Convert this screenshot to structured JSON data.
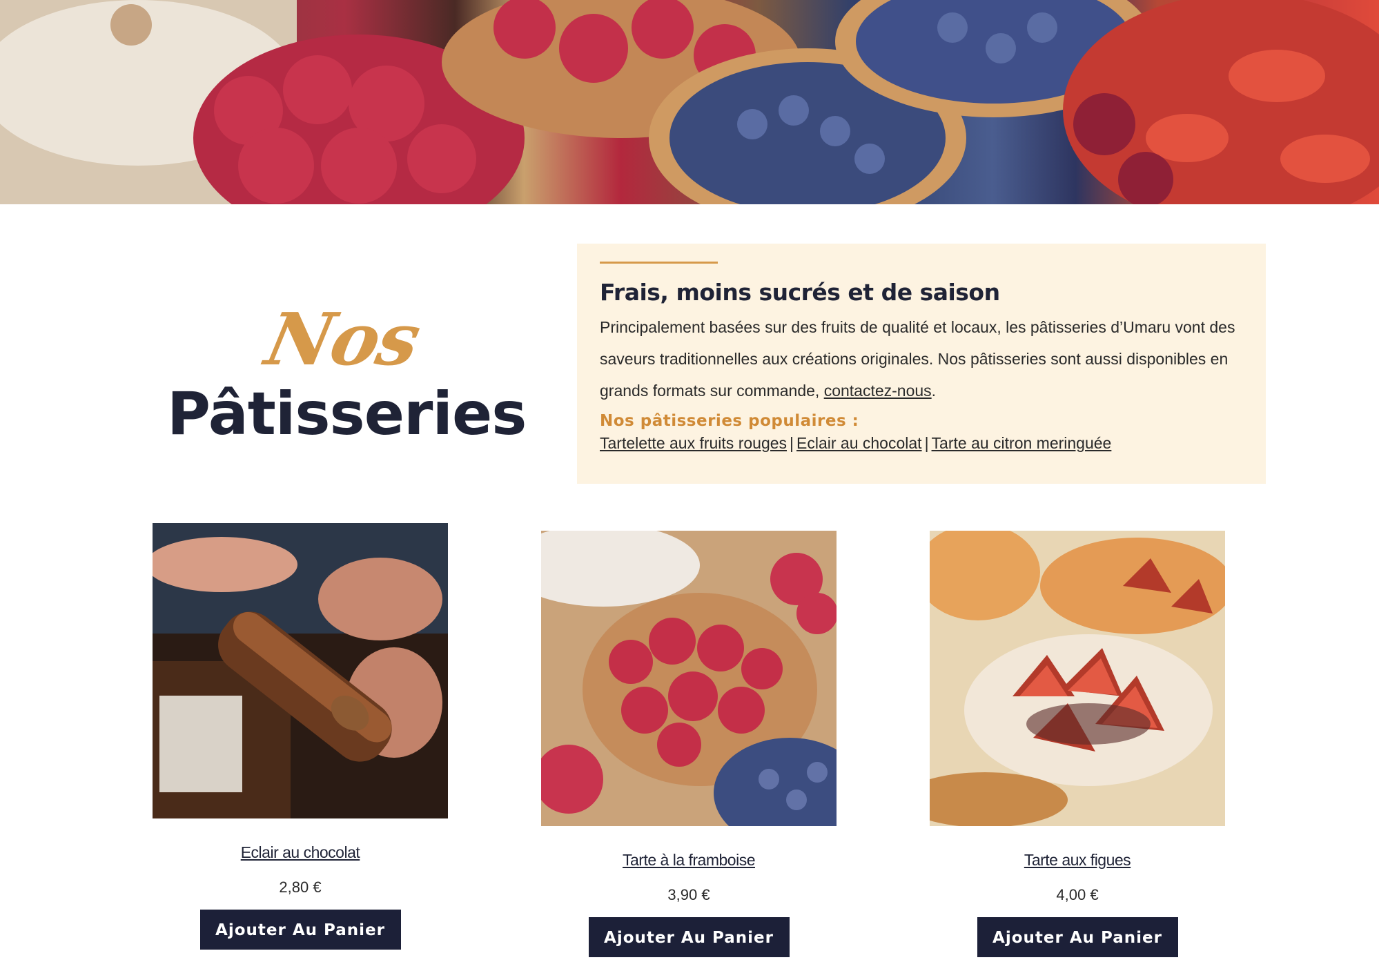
{
  "hero": {
    "alt": "Assortiment de tartelettes aux fruits"
  },
  "intro": {
    "title_script": "Nos",
    "title_main": "Pâtisseries",
    "heading": "Frais, moins sucrés et de saison",
    "paragraph_before_link": "Principalement basées sur des fruits de qualité et locaux, les pâtisseries d’Umaru vont des saveurs traditionnelles aux créations originales. Nos pâtisseries sont aussi disponibles en grands formats sur commande, ",
    "contact_link": "contactez-nous",
    "paragraph_after_link": ".",
    "popular_heading": "Nos pâtisseries populaires :",
    "popular_links": [
      "Tartelette aux fruits rouges",
      "Eclair au chocolat",
      "Tarte au citron meringuée"
    ],
    "separator": "|"
  },
  "products": [
    {
      "name": "Eclair au chocolat",
      "price": "2,80 €",
      "button": "Ajouter Au Panier"
    },
    {
      "name": "Tarte à la framboise",
      "price": "3,90 €",
      "button": "Ajouter Au Panier"
    },
    {
      "name": "Tarte aux figues",
      "price": "4,00 €",
      "button": "Ajouter Au Panier"
    }
  ],
  "colors": {
    "accent": "#d6994a",
    "dark": "#1f2336",
    "button_bg": "#1c2038",
    "info_bg": "#fdf3e1"
  }
}
